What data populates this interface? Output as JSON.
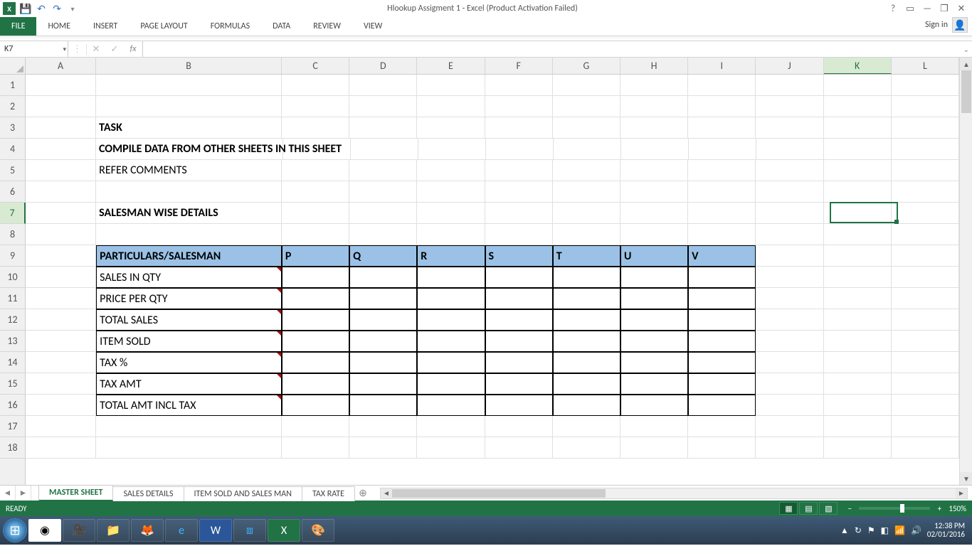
{
  "title": "Hlookup Assigment 1 - Excel (Product Activation Failed)",
  "qat": {
    "save": "💾",
    "undo": "↶",
    "redo": "↷"
  },
  "ribbon": {
    "file": "FILE",
    "tabs": [
      "HOME",
      "INSERT",
      "PAGE LAYOUT",
      "FORMULAS",
      "DATA",
      "REVIEW",
      "VIEW"
    ],
    "signin": "Sign in"
  },
  "namebox": "K7",
  "formula": "",
  "columns": [
    "A",
    "B",
    "C",
    "D",
    "E",
    "F",
    "G",
    "H",
    "I",
    "J",
    "K",
    "L"
  ],
  "selectedCol": "K",
  "rownums": [
    "1",
    "2",
    "3",
    "4",
    "5",
    "6",
    "7",
    "8",
    "9",
    "10",
    "11",
    "12",
    "13",
    "14",
    "15",
    "16",
    "17",
    "18"
  ],
  "selectedRow": "7",
  "cells": {
    "B3": "TASK",
    "B4": "COMPILE DATA FROM OTHER SHEETS IN THIS SHEET",
    "B5": "REFER COMMENTS",
    "B7": "SALESMAN WISE DETAILS",
    "B9": "PARTICULARS/SALESMAN",
    "C9": "P",
    "D9": "Q",
    "E9": "R",
    "F9": "S",
    "G9": "T",
    "H9": "U",
    "I9": "V",
    "B10": "SALES IN QTY",
    "B11": "PRICE PER QTY",
    "B12": "TOTAL SALES",
    "B13": "ITEM SOLD",
    "B14": "TAX %",
    "B15": "TAX AMT",
    "B16": "TOTAL AMT INCL TAX"
  },
  "sheets": {
    "active": "MASTER SHEET",
    "tabs": [
      "MASTER SHEET",
      "SALES DETAILS",
      "ITEM SOLD AND SALES MAN",
      "TAX RATE"
    ]
  },
  "status": {
    "ready": "READY",
    "zoom": "150%"
  },
  "tray": {
    "time": "12:38 PM",
    "date": "02/01/2016"
  }
}
